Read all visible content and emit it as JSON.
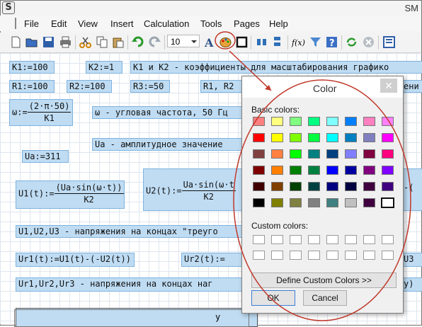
{
  "window": {
    "title": "SM"
  },
  "menu": [
    "File",
    "Edit",
    "View",
    "Insert",
    "Calculation",
    "Tools",
    "Pages",
    "Help"
  ],
  "toolbar": {
    "font_size": "10",
    "fx_label": "f(x)",
    "icons": [
      "new-doc-icon",
      "open-folder-icon",
      "save-icon",
      "print-icon",
      "cut-icon",
      "copy-icon",
      "paste-icon",
      "undo-icon",
      "redo-icon",
      "text-style-icon",
      "color-palette-icon",
      "border-icon",
      "align-left-icon",
      "align-top-icon",
      "function-icon",
      "filter-icon",
      "help-icon",
      "recalculate-icon",
      "stop-icon",
      "layout-icon"
    ]
  },
  "worksheet": {
    "k1": "K1:=100",
    "k2": "K2:=1",
    "k_note": "K1 и K2 - коэффициенты для масштабирования графико",
    "r1": "R1:=100",
    "r2": "R2:=100",
    "r3": "R3:=50",
    "r_note": "R1, R2",
    "r_note_tail": "ени",
    "omega_lhs": "ω:=",
    "omega_num": "(2·π·50)",
    "omega_den": "K1",
    "omega_note": "ω - угловая частота, 50 Гц",
    "ua_note": "Ua - амплитудное значение",
    "ua": "Ua:=311",
    "u1_lhs": "U1(t):=",
    "u1_num": "(Ua·sin(ω·t))",
    "u1_den": "K2",
    "u2_lhs": "U2(t):=",
    "u2_num": "Ua·sin(ω·t",
    "u2_den": "K2",
    "u2_tail": "-(",
    "u_note": "U1,U2,U3 - напряжения на концах \"треуго",
    "ur1": "Ur1(t):=U1(t)-(-U2(t))",
    "ur2": "Ur2(t):=",
    "ur3": "U3",
    "ur_note": "Ur1,Ur2,Ur3 - напряжения на концах наг",
    "ur_note_tail": "у)",
    "plot_ylabel": "y"
  },
  "dialog": {
    "title": "Color",
    "basic_label": "Basic colors:",
    "custom_label": "Custom colors:",
    "define_button": "Define Custom Colors >>",
    "ok": "OK",
    "cancel": "Cancel",
    "basic_colors": [
      [
        "#ff8080",
        "#ffff80",
        "#80ff80",
        "#00ff80",
        "#80ffff",
        "#0080ff",
        "#ff80c0",
        "#ff80ff"
      ],
      [
        "#ff0000",
        "#ffff00",
        "#80ff00",
        "#00ff40",
        "#00ffff",
        "#0080c0",
        "#8080c0",
        "#ff00ff"
      ],
      [
        "#804040",
        "#ff8040",
        "#00ff00",
        "#008080",
        "#004080",
        "#8080ff",
        "#800040",
        "#ff0080"
      ],
      [
        "#800000",
        "#ff8000",
        "#008000",
        "#008040",
        "#0000ff",
        "#0000a0",
        "#800080",
        "#8000ff"
      ],
      [
        "#400000",
        "#804000",
        "#004000",
        "#004040",
        "#000080",
        "#000040",
        "#400040",
        "#400080"
      ],
      [
        "#000000",
        "#808000",
        "#808040",
        "#808080",
        "#408080",
        "#c0c0c0",
        "#400040",
        "#ffffff"
      ]
    ]
  },
  "annotation": {
    "color": "#c0392b"
  }
}
